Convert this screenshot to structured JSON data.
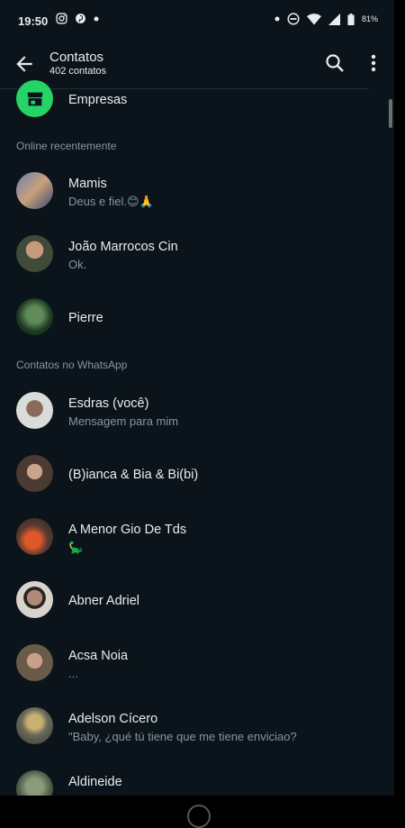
{
  "statusbar": {
    "time": "19:50",
    "battery": "81%"
  },
  "appbar": {
    "title": "Contatos",
    "subtitle": "402 contatos"
  },
  "business_row": {
    "label": "Empresas"
  },
  "sections": {
    "recent": "Online recentemente",
    "whatsapp": "Contatos no WhatsApp"
  },
  "recent": [
    {
      "name": "Mamis",
      "status": "Deus e fiel.😊🙏"
    },
    {
      "name": "João Marrocos Cin",
      "status": "Ok."
    },
    {
      "name": "Pierre",
      "status": ""
    }
  ],
  "contacts": [
    {
      "name": "Esdras (você)",
      "status": "Mensagem para mim"
    },
    {
      "name": "(B)ianca & Bia & Bi(bi)",
      "status": ""
    },
    {
      "name": "A Menor Gio De Tds",
      "status": "🦕"
    },
    {
      "name": "Abner Adriel",
      "status": ""
    },
    {
      "name": "Acsa Noia",
      "status": "..."
    },
    {
      "name": "Adelson Cícero",
      "status": "\"Baby, ¿qué tú tiene que me tiene enviciao?"
    },
    {
      "name": "Aldineide",
      "status": ""
    }
  ],
  "colors": {
    "background": "#0b141a",
    "accent": "#25d366",
    "secondary_text": "#8696a0"
  },
  "icons": [
    "arrow-back-icon",
    "search-icon",
    "more-vert-icon",
    "store-icon",
    "instagram-icon",
    "pinterest-icon",
    "wifi-icon",
    "signal-icon",
    "battery-icon",
    "dnd-icon"
  ]
}
